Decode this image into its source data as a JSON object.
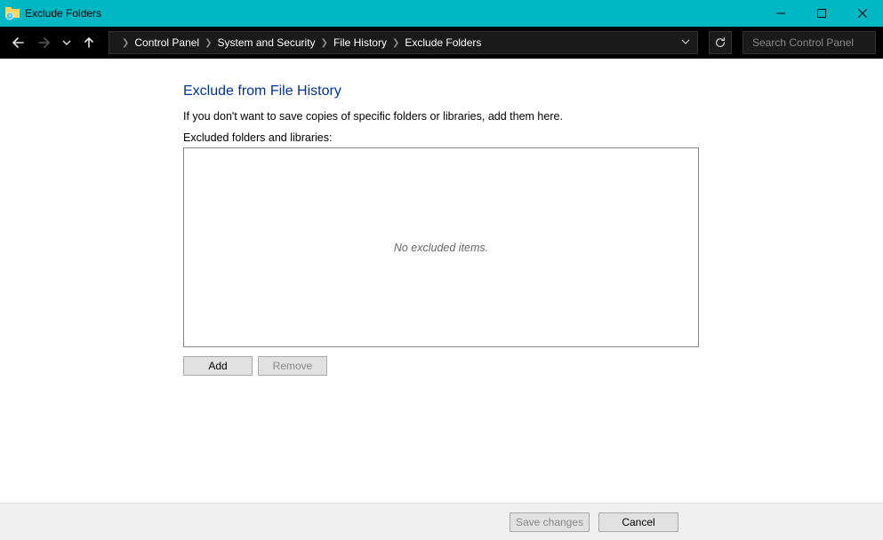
{
  "window": {
    "title": "Exclude Folders"
  },
  "breadcrumbs": {
    "0": "Control Panel",
    "1": "System and Security",
    "2": "File History",
    "3": "Exclude Folders"
  },
  "search": {
    "placeholder": "Search Control Panel"
  },
  "main": {
    "heading": "Exclude from File History",
    "description": "If you don't want to save copies of specific folders or libraries, add them here.",
    "list_label": "Excluded folders and libraries:",
    "empty_text": "No excluded items.",
    "add_label": "Add",
    "remove_label": "Remove"
  },
  "footer": {
    "save_label": "Save changes",
    "cancel_label": "Cancel"
  }
}
